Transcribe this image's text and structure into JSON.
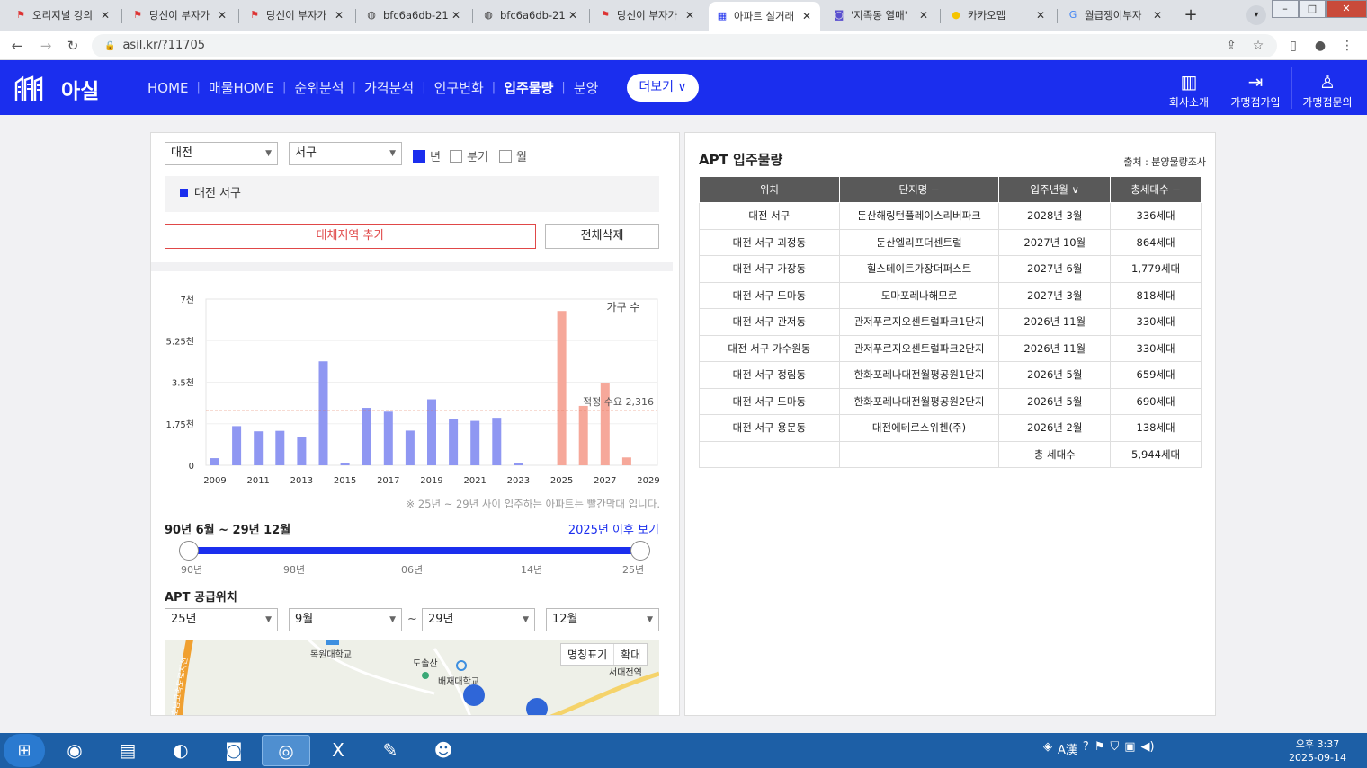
{
  "browser": {
    "tabs": [
      {
        "icon": "flag-icon",
        "title": "오리지널 강의"
      },
      {
        "icon": "flag-icon",
        "title": "당신이 부자가"
      },
      {
        "icon": "flag-icon",
        "title": "당신이 부자가"
      },
      {
        "icon": "globe-icon",
        "title": "bfc6a6db-21"
      },
      {
        "icon": "globe-icon",
        "title": "bfc6a6db-21"
      },
      {
        "icon": "flag-icon",
        "title": "당신이 부자가"
      },
      {
        "icon": "asil-icon",
        "title": "아파트 실거래"
      },
      {
        "icon": "camera-icon",
        "title": "'지족동 열매'"
      },
      {
        "icon": "kakao-pin-icon",
        "title": "카카오맵"
      },
      {
        "icon": "google-icon",
        "title": "월급쟁이부자"
      }
    ],
    "active_tab": 6,
    "url": "asil.kr/?11705"
  },
  "site": {
    "logo_text": "아실",
    "menu": [
      "HOME",
      "매물HOME",
      "순위분석",
      "가격분석",
      "인구변화",
      "입주물량",
      "분양"
    ],
    "menu_active": "입주물량",
    "more_label": "더보기",
    "right_nav": [
      {
        "icon": "building-icon",
        "label": "회사소개"
      },
      {
        "icon": "login-icon",
        "label": "가맹점가입"
      },
      {
        "icon": "person-stars-icon",
        "label": "가맹점문의"
      }
    ]
  },
  "filter": {
    "city": "대전",
    "district": "서구",
    "period_options": [
      {
        "label": "년",
        "checked": true
      },
      {
        "label": "분기",
        "checked": false
      },
      {
        "label": "월",
        "checked": false
      }
    ],
    "selected_region": "대전 서구",
    "add_region_label": "대체지역 추가",
    "delete_all_label": "전체삭제"
  },
  "chart_data": {
    "type": "bar",
    "series_label": "가구 수",
    "categories": [
      "2009",
      "2010",
      "2011",
      "2012",
      "2013",
      "2014",
      "2015",
      "2016",
      "2017",
      "2018",
      "2019",
      "2020",
      "2021",
      "2022",
      "2023",
      "2024",
      "2025",
      "2026",
      "2027",
      "2028",
      "2029"
    ],
    "values": [
      300,
      1650,
      1430,
      1450,
      1200,
      4380,
      100,
      2420,
      2260,
      1460,
      2780,
      1930,
      1870,
      2000,
      100,
      0,
      6500,
      2500,
      3480,
      330,
      0
    ],
    "highlight_from": "2025",
    "color_normal": "#8f97f2",
    "color_highlight": "#f6a89a",
    "xtick_labels": [
      "2009",
      "2011",
      "2013",
      "2015",
      "2017",
      "2019",
      "2021",
      "2023",
      "2025",
      "2027",
      "2029"
    ],
    "ytick_labels": [
      "0",
      "1.75천",
      "3.5천",
      "5.25천",
      "7천"
    ],
    "ylim": [
      0,
      7000
    ],
    "reference_value": 2316,
    "reference_label": "적정 수요 2,316"
  },
  "chart_note": "※ 25년 ~ 29년 사이 입주하는 아파트는 빨간막대 입니다.",
  "range": {
    "label": "90년 6월 ~ 29년 12월",
    "after_link": "2025년 이후 보기",
    "ticks": [
      "90년",
      "98년",
      "06년",
      "14년",
      "25년"
    ]
  },
  "supply": {
    "title": "APT 공급위치",
    "from_year": "25년",
    "from_month": "9월",
    "tilde": "~",
    "to_year": "29년",
    "to_month": "12월"
  },
  "map": {
    "buttons": [
      "명칭표기",
      "확대"
    ],
    "labels": [
      "목원대학교",
      "도솔산",
      "배재대학교",
      "서대전역",
      "호남고속도로지선"
    ]
  },
  "table": {
    "title": "APT 입주물량",
    "source": "출처 : 분양물량조사",
    "headers": [
      "위치",
      "단지명 −",
      "입주년월 ∨",
      "총세대수 −"
    ],
    "rows": [
      [
        "대전 서구",
        "둔산해링턴플레이스리버파크",
        "2028년 3월",
        "336세대"
      ],
      [
        "대전 서구 괴정동",
        "둔산엘리프더센트럴",
        "2027년 10월",
        "864세대"
      ],
      [
        "대전 서구 가장동",
        "힐스테이트가장더퍼스트",
        "2027년 6월",
        "1,779세대"
      ],
      [
        "대전 서구 도마동",
        "도마포레나해모로",
        "2027년 3월",
        "818세대"
      ],
      [
        "대전 서구 관저동",
        "관저푸르지오센트럴파크1단지",
        "2026년 11월",
        "330세대"
      ],
      [
        "대전 서구 가수원동",
        "관저푸르지오센트럴파크2단지",
        "2026년 11월",
        "330세대"
      ],
      [
        "대전 서구 정림동",
        "한화포레나대전월평공원1단지",
        "2026년 5월",
        "659세대"
      ],
      [
        "대전 서구 도마동",
        "한화포레나대전월평공원2단지",
        "2026년 5월",
        "690세대"
      ],
      [
        "대전 서구 용문동",
        "대전에테르스위첸(주)",
        "2026년 2월",
        "138세대"
      ]
    ],
    "total_label": "총 세대수",
    "total_value": "5,944세대"
  },
  "taskbar": {
    "apps": [
      "start-orb-icon",
      "red-app-icon",
      "explorer-icon",
      "green-app-icon",
      "zoom-icon",
      "chrome-icon",
      "excel-icon",
      "paint-icon",
      "owl-app-icon"
    ],
    "tray_ime": "A漢",
    "time": "오후 3:37",
    "date": "2025-09-14"
  }
}
